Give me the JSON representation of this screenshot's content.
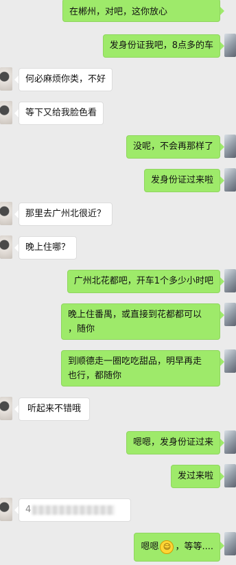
{
  "messages": [
    {
      "side": "out",
      "text": "在郴州，对吧，这你放心"
    },
    {
      "side": "out",
      "text": "发身份证我吧，8点多的车"
    },
    {
      "side": "in",
      "text": "何必麻烦你类，不好"
    },
    {
      "side": "in",
      "text": "等下又给我脸色看"
    },
    {
      "side": "out",
      "text": "没呢，不会再那样了"
    },
    {
      "side": "out",
      "text": "发身份证过来啦"
    },
    {
      "side": "in",
      "text": "那里去广州北很近？"
    },
    {
      "side": "in",
      "text": "晚上住哪？"
    },
    {
      "side": "out",
      "text": "广州北花都吧，开车1个多少小时吧"
    },
    {
      "side": "out",
      "line1": "晚上住番禺，或直接到花都都可以",
      "line2": "，随你"
    },
    {
      "side": "out",
      "line1": "到顺德走一圈吃吃甜品，明早再走",
      "line2": "也行，都随你"
    },
    {
      "side": "in",
      "text": "听起来不错哦"
    },
    {
      "side": "out",
      "text": "嗯嗯，发身份证过来"
    },
    {
      "side": "out",
      "text": "发过来啦"
    },
    {
      "side": "in",
      "prefix": "4"
    },
    {
      "side": "out",
      "before": "嗯嗯",
      "after": "，等等...."
    }
  ],
  "icons": {
    "emoji": "smiley-emoji-icon",
    "avatar_self": "avatar",
    "avatar_other": "avatar"
  }
}
